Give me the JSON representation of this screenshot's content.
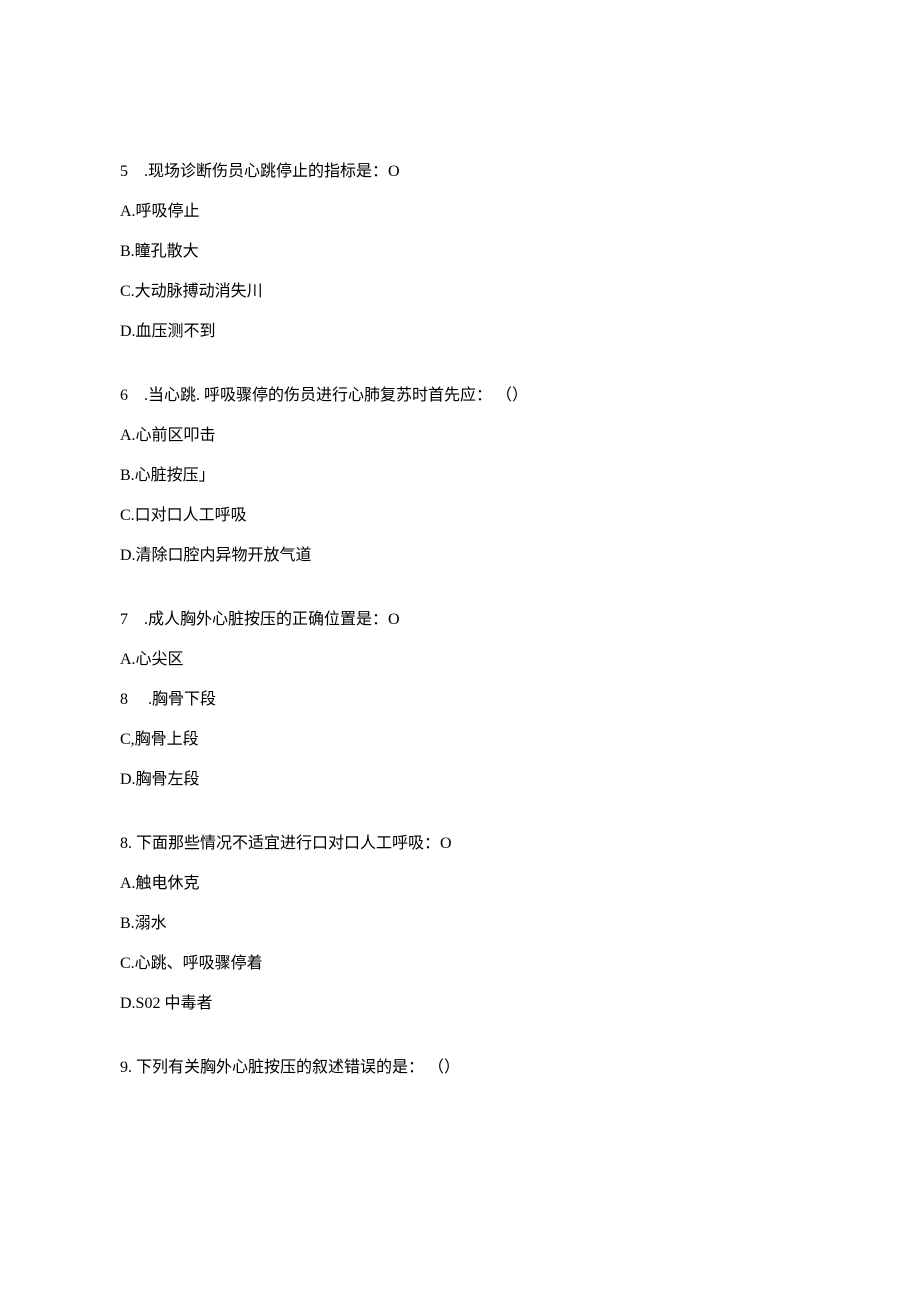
{
  "q5": {
    "num": "5",
    "sep": "   .",
    "stem": "现场诊断伤员心跳停止的指标是：O",
    "A": "A.呼吸停止",
    "B": "B.瞳孔散大",
    "C": "C.大动脉搏动消失川",
    "D": "D.血压测不到"
  },
  "q6": {
    "num": "6",
    "sep": "   .",
    "stem": "当心跳. 呼吸骤停的伤员进行心肺复苏时首先应： （）",
    "A": "A.心前区叩击",
    "B": "B.心脏按压」",
    "C": "C.口对口人工呼吸",
    "D": "D.清除口腔内异物开放气道"
  },
  "q7": {
    "num": "7",
    "sep": "   .",
    "stem": "成人胸外心脏按压的正确位置是：O",
    "A": "A.心尖区",
    "Bnum": "8",
    "Bsep": "    .",
    "B": "胸骨下段",
    "C": "C,胸骨上段",
    "D": "D.胸骨左段"
  },
  "q8": {
    "num": "8. ",
    "stem": "下面那些情况不适宜进行口对口人工呼吸：O",
    "A": "A.触电休克",
    "B": "B.溺水",
    "C": "C.心跳、呼吸骤停着",
    "D": "D.S02 中毒者"
  },
  "q9": {
    "num": "9. ",
    "stem": "下列有关胸外心脏按压的叙述错误的是： （）"
  }
}
